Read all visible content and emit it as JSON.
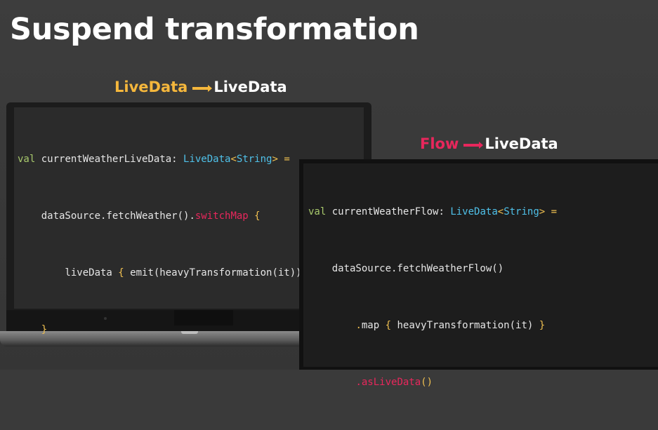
{
  "title": "Suspend transformation",
  "colors": {
    "background": "#3a3a3a",
    "livedata_accent": "#f5b73c",
    "flow_accent": "#e8275c",
    "type_color": "#4fc1e9",
    "keyword_color": "#a8c96c"
  },
  "label_livedata": {
    "from": "LiveData",
    "to": "LiveData"
  },
  "label_flow": {
    "from": "Flow",
    "to": "LiveData"
  },
  "code_livedata": {
    "l1_kw": "val",
    "l1_name": " currentWeatherLiveData: ",
    "l1_type": "LiveData",
    "l1_lt": "<",
    "l1_type2": "String",
    "l1_gt": ">",
    "l1_eq": " =",
    "l2_a": "    dataSource.fetchWeather()",
    "l2_dot": ".",
    "l2_fn": "switchMap",
    "l2_brace": " {",
    "l3_a": "        liveData ",
    "l3_brace": "{",
    "l3_b": " emit(heavyTransformation(it)) }",
    "l4_brace": "    }"
  },
  "code_flow": {
    "l1_kw": "val",
    "l1_name": " currentWeatherFlow: ",
    "l1_type": "LiveData",
    "l1_lt": "<",
    "l1_type2": "String",
    "l1_gt": ">",
    "l1_eq": " =",
    "l2": "    dataSource.fetchWeatherFlow()",
    "l3_indent": "        ",
    "l3_dot": ".",
    "l3_fn": "map",
    "l3_b1": " {",
    "l3_mid": " heavyTransformation(it) ",
    "l3_b2": "}",
    "l4_indent": "        ",
    "l4_dot": ".",
    "l4_fn": "asLiveData",
    "l4_paren": "()"
  }
}
